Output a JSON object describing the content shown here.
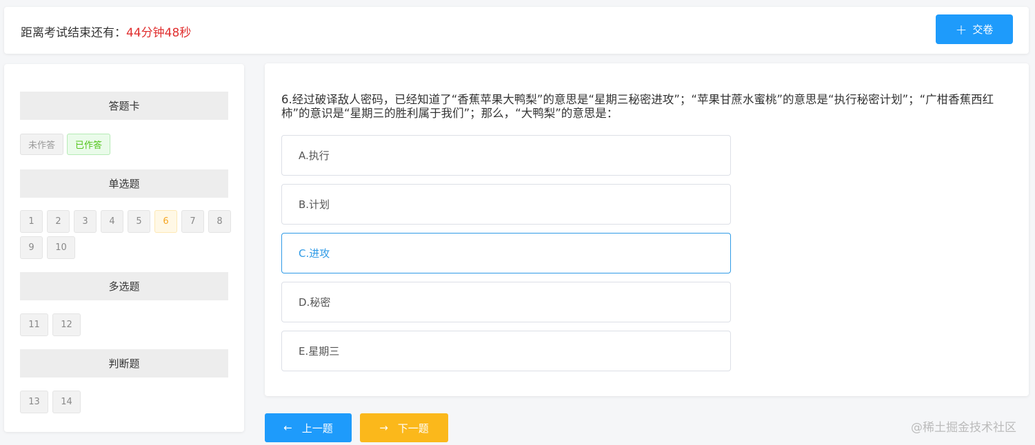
{
  "header": {
    "timer_label": "距离考试结束还有：",
    "timer_value": "44分钟48秒",
    "submit_icon": "+",
    "submit_label": "交卷"
  },
  "answer_card": {
    "title": "答题卡",
    "legend": {
      "unanswered": "未作答",
      "answered": "已作答"
    },
    "sections": [
      {
        "title": "单选题",
        "numbers": [
          "1",
          "2",
          "3",
          "4",
          "5",
          "6",
          "7",
          "8",
          "9",
          "10"
        ],
        "current": "6"
      },
      {
        "title": "多选题",
        "numbers": [
          "11",
          "12"
        ]
      },
      {
        "title": "判断题",
        "numbers": [
          "13",
          "14"
        ]
      }
    ]
  },
  "question": {
    "text": "6.经过破译敌人密码，已经知道了“香蕉苹果大鸭梨”的意思是“星期三秘密进攻”；“苹果甘蔗水蜜桃”的意思是“执行秘密计划”；“广柑香蕉西红柿”的意识是“星期三的胜利属于我们”；那么，“大鸭梨”的意思是：",
    "options": [
      {
        "label": "A.执行",
        "selected": false
      },
      {
        "label": "B.计划",
        "selected": false
      },
      {
        "label": "C.进攻",
        "selected": true
      },
      {
        "label": "D.秘密",
        "selected": false
      },
      {
        "label": "E.星期三",
        "selected": false
      }
    ]
  },
  "nav": {
    "prev_icon": "←",
    "prev_label": "上一题",
    "next_icon": "→",
    "next_label": "下一题"
  },
  "watermark": "@稀土掘金技术社区",
  "colors": {
    "primary": "#1e9bfb",
    "warning": "#fbb81b",
    "timer": "#e02f2f",
    "selected_option": "#2e9ae6",
    "answered": "#52c41a"
  }
}
